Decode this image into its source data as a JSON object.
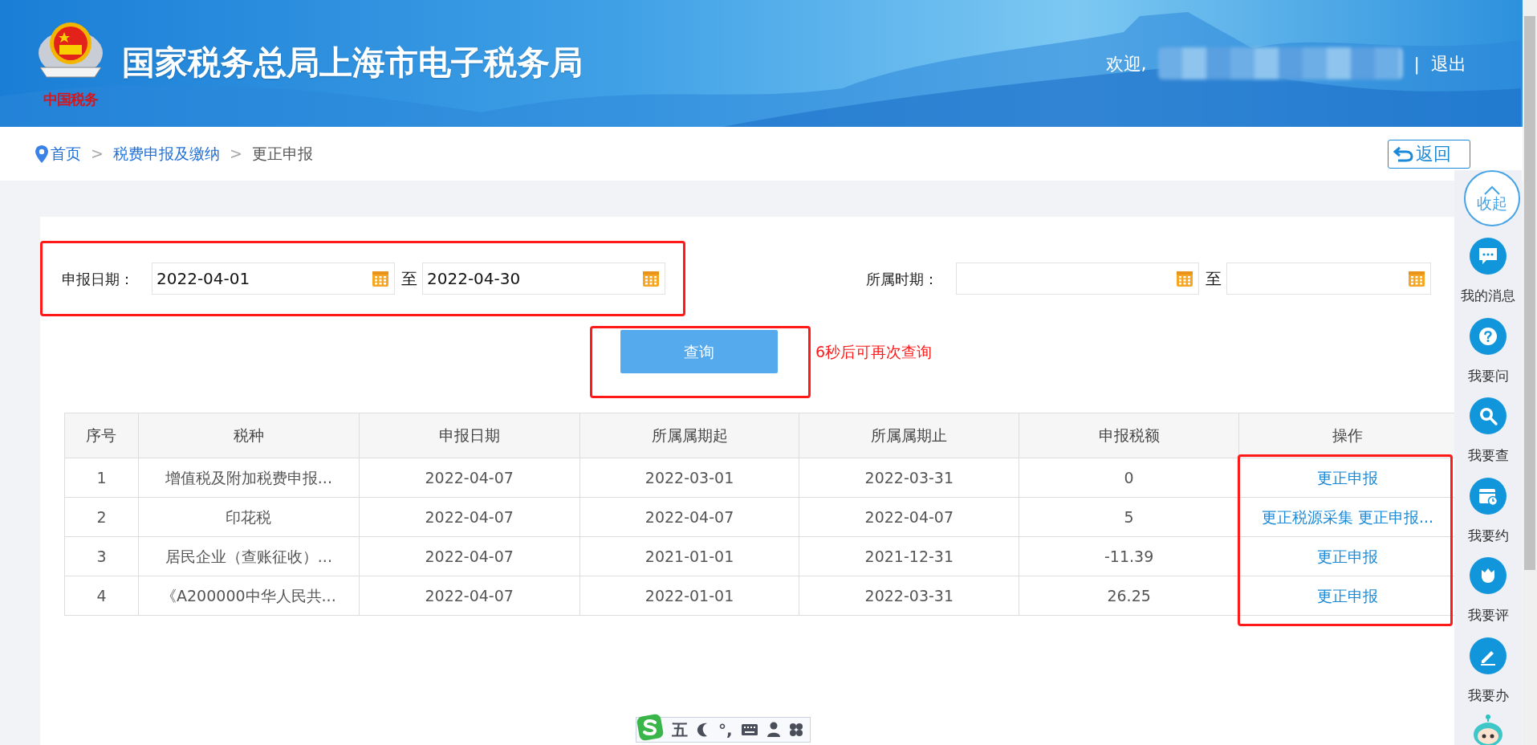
{
  "header": {
    "logo_text": "中国税务",
    "title": "国家税务总局上海市电子税务局",
    "welcome": "欢迎,",
    "separator": "|",
    "logout": "退出"
  },
  "breadcrumb": {
    "separator": ">",
    "items": [
      {
        "label": "首页",
        "link": true
      },
      {
        "label": "税费申报及缴纳",
        "link": true
      },
      {
        "label": "更正申报",
        "link": false
      }
    ]
  },
  "back_button": {
    "label": "返回"
  },
  "filters": [
    {
      "label": "申报日期：",
      "from": "2022-04-01",
      "joiner": "至",
      "to": "2022-04-30",
      "highlighted": true
    },
    {
      "label": "所属时期：",
      "joiner": "至",
      "highlighted": false
    }
  ],
  "query": {
    "label": "查询",
    "countdown": "6秒后可再次查询",
    "highlighted": true
  },
  "table": {
    "columns": [
      "序号",
      "税种",
      "申报日期",
      "所属属期起",
      "所属属期止",
      "申报税额",
      "操作"
    ],
    "actions_highlighted": true,
    "rows": [
      {
        "cells": [
          "1",
          "增值税及附加税费申报...",
          "2022-04-07",
          "2022-03-01",
          "2022-03-31",
          "0"
        ],
        "actions": [
          "更正申报"
        ]
      },
      {
        "cells": [
          "2",
          "印花税",
          "2022-04-07",
          "2022-04-07",
          "2022-04-07",
          "5"
        ],
        "actions": [
          "更正税源采集",
          "更正申报..."
        ]
      },
      {
        "cells": [
          "3",
          "居民企业（查账征收）...",
          "2022-04-07",
          "2021-01-01",
          "2021-12-31",
          "-11.39"
        ],
        "actions": [
          "更正申报"
        ]
      },
      {
        "cells": [
          "4",
          "《A200000中华人民共...",
          "2022-04-07",
          "2022-01-01",
          "2022-03-31",
          "26.25"
        ],
        "actions": [
          "更正申报"
        ]
      }
    ]
  },
  "side_menu": {
    "collapse": "收起",
    "items": [
      {
        "label": "我的消息",
        "kind": "message"
      },
      {
        "label": "我要问",
        "kind": "question"
      },
      {
        "label": "我要查",
        "kind": "search"
      },
      {
        "label": "我要约",
        "kind": "calendar"
      },
      {
        "label": "我要评",
        "kind": "flower"
      },
      {
        "label": "我要办",
        "kind": "pen"
      }
    ]
  },
  "ime_bar": {
    "mode": "五",
    "punctuation": "°,"
  }
}
